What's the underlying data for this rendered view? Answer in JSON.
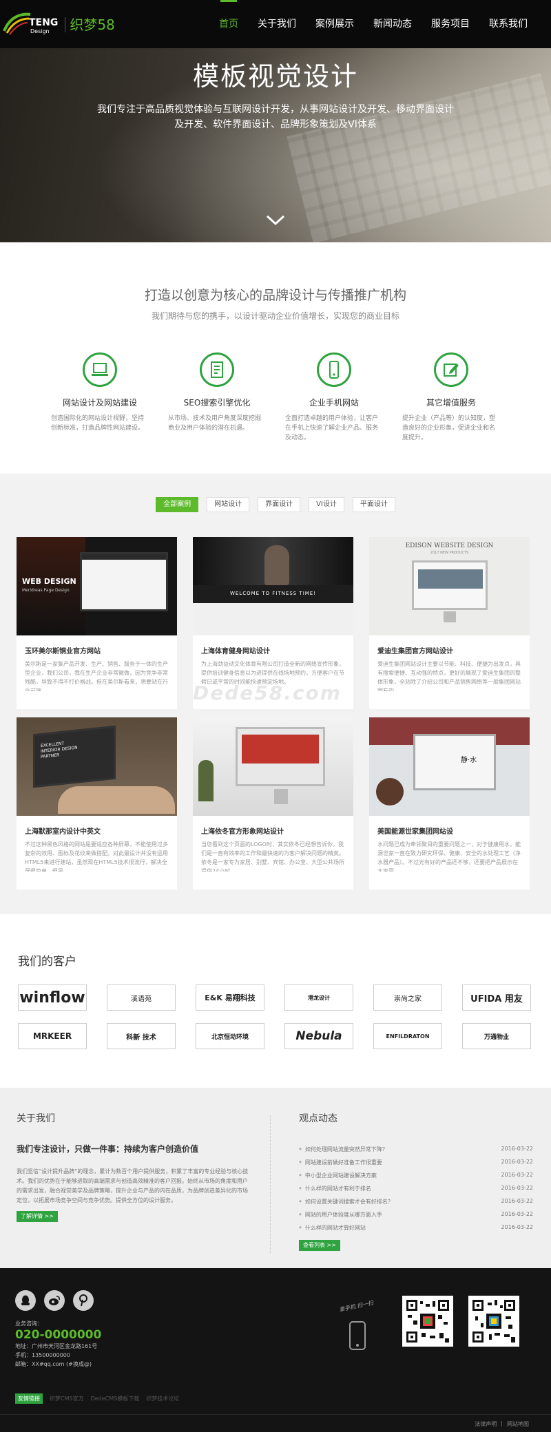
{
  "brand": {
    "teng": "TENG",
    "design": "Design",
    "name_cn": "织梦58"
  },
  "nav": {
    "items": [
      {
        "label": "首页"
      },
      {
        "label": "关于我们"
      },
      {
        "label": "案例展示"
      },
      {
        "label": "新闻动态"
      },
      {
        "label": "服务项目"
      },
      {
        "label": "联系我们"
      }
    ]
  },
  "hero": {
    "title": "模板视觉设计",
    "subtitle": "我们专注于高品质视觉体验与互联网设计开发，从事网站设计及开发、移动界面设计及开发、软件界面设计、品牌形象策划及VI体系"
  },
  "intro": {
    "title": "打造以创意为核心的品牌设计与传播推广机构",
    "subtitle": "我们期待与您的携手，以设计驱动企业价值增长，实现您的商业目标"
  },
  "services": [
    {
      "icon": "laptop-icon",
      "title": "网站设计及网站建设",
      "desc": "创造国际化的网站设计视野，坚持创新标准，打造品牌性网站建设。"
    },
    {
      "icon": "document-icon",
      "title": "SEO搜索引擎优化",
      "desc": "从市场、技术及用户角度深度挖掘商业及用户体验的潜在机遇。"
    },
    {
      "icon": "mobile-icon",
      "title": "企业手机网站",
      "desc": "全面打造卓越的用户体验，让客户在手机上快速了解企业产品、服务及动态。"
    },
    {
      "icon": "edit-icon",
      "title": "其它增值服务",
      "desc": "提升企业（产品等）的认知度，塑造良好的企业形象，促进企业和名度提升。"
    }
  ],
  "filters": [
    {
      "label": "全部案例"
    },
    {
      "label": "网站设计"
    },
    {
      "label": "界面设计"
    },
    {
      "label": "VI设计"
    },
    {
      "label": "平面设计"
    }
  ],
  "cases": [
    {
      "title": "玉环美尔斯铜业官方网站",
      "desc": "美尔斯是一家集产品开发、生产、销售、服务于一体的生产型企业，我们公司，我在生产企业非常徽做，因为竞争非常残酷，导致不得不打价格战。但在美尔斯看来，想要站在行业前端，",
      "overlay": "WEB DESIGN",
      "overlay_sub": "Meridreas Page Design"
    },
    {
      "title": "上海体育健身网站设计",
      "desc": "为上海劲益动文化体育有限公司打造全新的网络宣传形象，提供培训健身信息以为进提供在线场地预约，方便客户在节假日或平常的时间能快速预定场地。",
      "overlay": "WELCOME TO FITNESS TIME!"
    },
    {
      "title": "爱迪生集团官方网站设计",
      "desc": "爱迪生集团网站设计主要以节能、科技、便捷为出发点，具有搜索便捷、互动强的特点，更好的展现了爱迪生集团的整体形象，全站除了介绍公司和产品销售网络等一般集团网站固有的",
      "overlay": "EDISON WEBSITE DESIGN",
      "overlay_sub": "2017 NEW PRODUCTS"
    },
    {
      "title": "上海默那室内设计中英文",
      "desc": "不过这种黑色风格的网站是要适应各种屏幕，不能使用过多复杂的效用、图标及花纹来做搭配。对此最设计并没有运用HTML5来进行建站，虽然现在HTML5技术很流行，解决全屏很简单，但是",
      "overlay": "EXCELLENT INTERIOR DESIGN PARTNER"
    },
    {
      "title": "上海依冬官方形象网站设计",
      "desc": "当您看到这个页面的LOGO时，其实依冬已经想告诉你，我们是一直有效率的工作和最快速的为客户解决问题的精英。依冬是一家专为家居、别墅、宾馆、办公室、大型公共场所提供24小时",
      "overlay": ""
    },
    {
      "title": "美国能源世家集团网站设",
      "desc": "水问题已成为牵领聚目的重要问题之一，对于健康用水，能源世家一直在致力研究环保、健康、安全的水处理工艺（净水器产品）。不过光有好的产品还不够，还要把产品展示在大家面",
      "overlay": "静·水"
    }
  ],
  "watermark": "Dede58.com",
  "clients": {
    "title": "我们的客户",
    "logos": [
      {
        "text": "winflow"
      },
      {
        "text": "溪语苑"
      },
      {
        "text": "E&K 易翔科技"
      },
      {
        "text": "港龙设计"
      },
      {
        "text": "崇尚之家"
      },
      {
        "text": "UFIDA 用友"
      },
      {
        "text": "MRKEER"
      },
      {
        "text": "科新 技术"
      },
      {
        "text": "北京恒动环境"
      },
      {
        "text": "Nebula"
      },
      {
        "text": "ENFILDRATON"
      },
      {
        "text": "万通物业"
      }
    ]
  },
  "about": {
    "title": "关于我们",
    "head": "我们专注设计，只做一件事：持续为客户创造价值",
    "text": "我们坚信“设计提升品牌”的理念，累计为数百个用户提供服务，积累了丰富的专业经验与核心技术。我们的优势在于能够进取的高端需求与创造高效精准的客户回报。始终从市场的角度和用户的需求出发，融合视觉美学及品牌策略，提升企业与产品的内在品质，为品牌创造差异化的市场定位，以拓展市场竞争空间与竞争优势。提供全方位的设计服务。",
    "more": "了解详情 >>"
  },
  "news": {
    "title": "观点动态",
    "items": [
      {
        "title": "如何处理网站流量突然异常下降？",
        "date": "2016-03-22"
      },
      {
        "title": "网站建设前做好准备工作很重要",
        "date": "2016-03-22"
      },
      {
        "title": "中小型企业网站建设解决方案",
        "date": "2016-03-22"
      },
      {
        "title": "什么样的网站才有利于排名",
        "date": "2016-03-22"
      },
      {
        "title": "如何设置关键词搜索才会有好排名？",
        "date": "2016-03-22"
      },
      {
        "title": "网站的用户体验度从哪方面入手",
        "date": "2016-03-22"
      },
      {
        "title": "什么样的网站才算好网站",
        "date": "2016-03-22"
      }
    ],
    "more": "查看列表 >>"
  },
  "footer": {
    "consult_label": "业务咨询：",
    "phone": "020-0000000",
    "address": "地址：广州市天河区金龙路161号",
    "mobile": "手机：13500000000",
    "email": "邮箱：XX#qq.com (#换成@)",
    "mobile_hint": "拿手机 扫一扫",
    "links_tag": "友情链接",
    "links": [
      {
        "label": "织梦CMS官方"
      },
      {
        "label": "DedeCMS模板下载"
      },
      {
        "label": "织梦技术论坛"
      }
    ],
    "bottom": {
      "legal": "法律声明",
      "sep": "|",
      "sitemap": "网站地图"
    }
  }
}
